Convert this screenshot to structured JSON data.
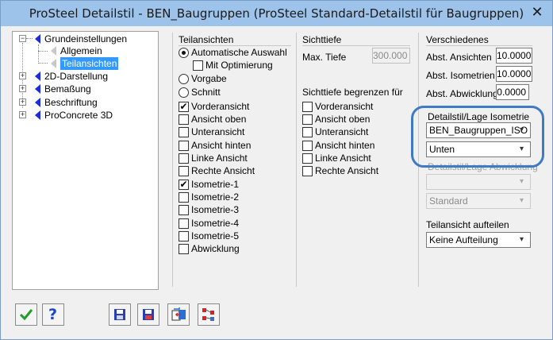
{
  "window": {
    "title": "ProSteel Detailstil - BEN_Baugruppen (ProSteel Standard-Detailstil für Baugruppen)",
    "close_glyph": "✕"
  },
  "tree": {
    "items": [
      {
        "label": "Grundeinstellungen",
        "expander": "−"
      },
      {
        "label": "Allgemein"
      },
      {
        "label": "Teilansichten"
      },
      {
        "label": "2D-Darstellung",
        "expander": "+"
      },
      {
        "label": "Bemaßung",
        "expander": "+"
      },
      {
        "label": "Beschriftung",
        "expander": "+"
      },
      {
        "label": "ProConcrete 3D",
        "expander": "+"
      }
    ]
  },
  "teilansichten": {
    "title": "Teilansichten",
    "auto": "Automatische Auswahl",
    "mit_optimierung": "Mit Optimierung",
    "vorgabe": "Vorgabe",
    "schnitt": "Schnitt",
    "views": [
      {
        "label": "Vorderansicht",
        "checked": "✔"
      },
      {
        "label": "Ansicht oben",
        "checked": ""
      },
      {
        "label": "Unteransicht",
        "checked": ""
      },
      {
        "label": "Ansicht hinten",
        "checked": ""
      },
      {
        "label": "Linke Ansicht",
        "checked": ""
      },
      {
        "label": "Rechte Ansicht",
        "checked": ""
      },
      {
        "label": "Isometrie-1",
        "checked": "✔"
      },
      {
        "label": "Isometrie-2",
        "checked": ""
      },
      {
        "label": "Isometrie-3",
        "checked": ""
      },
      {
        "label": "Isometrie-4",
        "checked": ""
      },
      {
        "label": "Isometrie-5",
        "checked": ""
      },
      {
        "label": "Abwicklung",
        "checked": ""
      }
    ]
  },
  "sichttiefe": {
    "title": "Sichttiefe",
    "max_label": "Max. Tiefe",
    "max_value": "300.000",
    "begrenzen_title": "Sichttiefe begrenzen für",
    "items": [
      "Vorderansicht",
      "Ansicht oben",
      "Unteransicht",
      "Ansicht hinten",
      "Linke Ansicht",
      "Rechte Ansicht"
    ]
  },
  "verschiedenes": {
    "title": "Verschiedenes",
    "abst_ansichten_label": "Abst. Ansichten",
    "abst_ansichten_value": "10.0000",
    "abst_isometrien_label": "Abst. Isometrien",
    "abst_isometrien_value": "10.0000",
    "abst_abwicklung_label": "Abst. Abwicklung",
    "abst_abwicklung_value": "0.0000",
    "iso_label": "Detailstil/Lage Isometrie",
    "iso_style": "BEN_Baugruppen_ISO",
    "iso_position": "Unten",
    "abw_label": "Detailstil/Lage Abwicklung",
    "abw_style": "",
    "abw_position": "Standard",
    "aufteilen_label": "Teilansicht aufteilen",
    "aufteilen_value": "Keine Aufteilung",
    "arrow": "▾"
  },
  "toolbar": {
    "ok_glyph": "✔",
    "help_glyph": "?"
  },
  "colors": {
    "titlebar": "#9ec3ea",
    "tree_arrow": "#1c2be0",
    "selection": "#3399ff",
    "highlight_ring": "#3d7bc4"
  }
}
